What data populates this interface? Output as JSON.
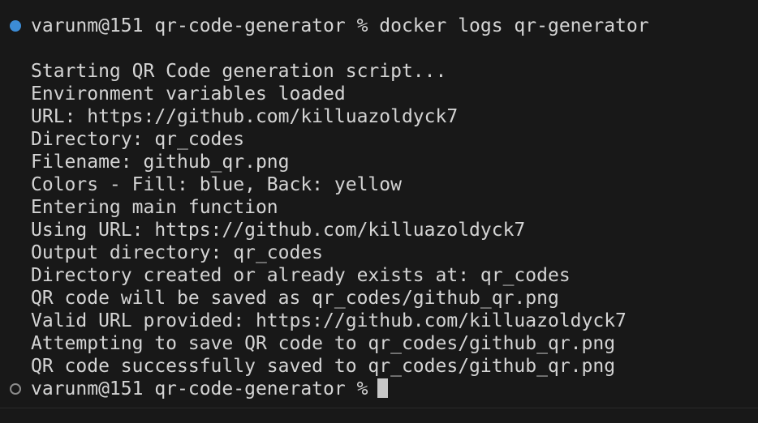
{
  "terminal": {
    "command_prompt": "varunm@151 qr-code-generator % docker logs qr-generator",
    "output_lines": [
      "Starting QR Code generation script...",
      "Environment variables loaded",
      "URL: https://github.com/killuazoldyck7",
      "Directory: qr_codes",
      "Filename: github_qr.png",
      "Colors - Fill: blue, Back: yellow",
      "Entering main function",
      "Using URL: https://github.com/killuazoldyck7",
      "Output directory: qr_codes",
      "Directory created or already exists at: qr_codes",
      "QR code will be saved as qr_codes/github_qr.png",
      "Valid URL provided: https://github.com/killuazoldyck7",
      "Attempting to save QR code to qr_codes/github_qr.png",
      "QR code successfully saved to qr_codes/github_qr.png"
    ],
    "current_prompt": "varunm@151 qr-code-generator %"
  },
  "colors": {
    "background": "#181818",
    "text": "#d4d4d4",
    "command_marker_success": "#3c8cd6",
    "command_marker_pending": "#8c8c8c",
    "cursor": "#c8c8c8"
  },
  "icons": {
    "command_decoration": "filled-circle-icon",
    "prompt_decoration": "hollow-circle-icon",
    "cursor": "block-cursor"
  }
}
